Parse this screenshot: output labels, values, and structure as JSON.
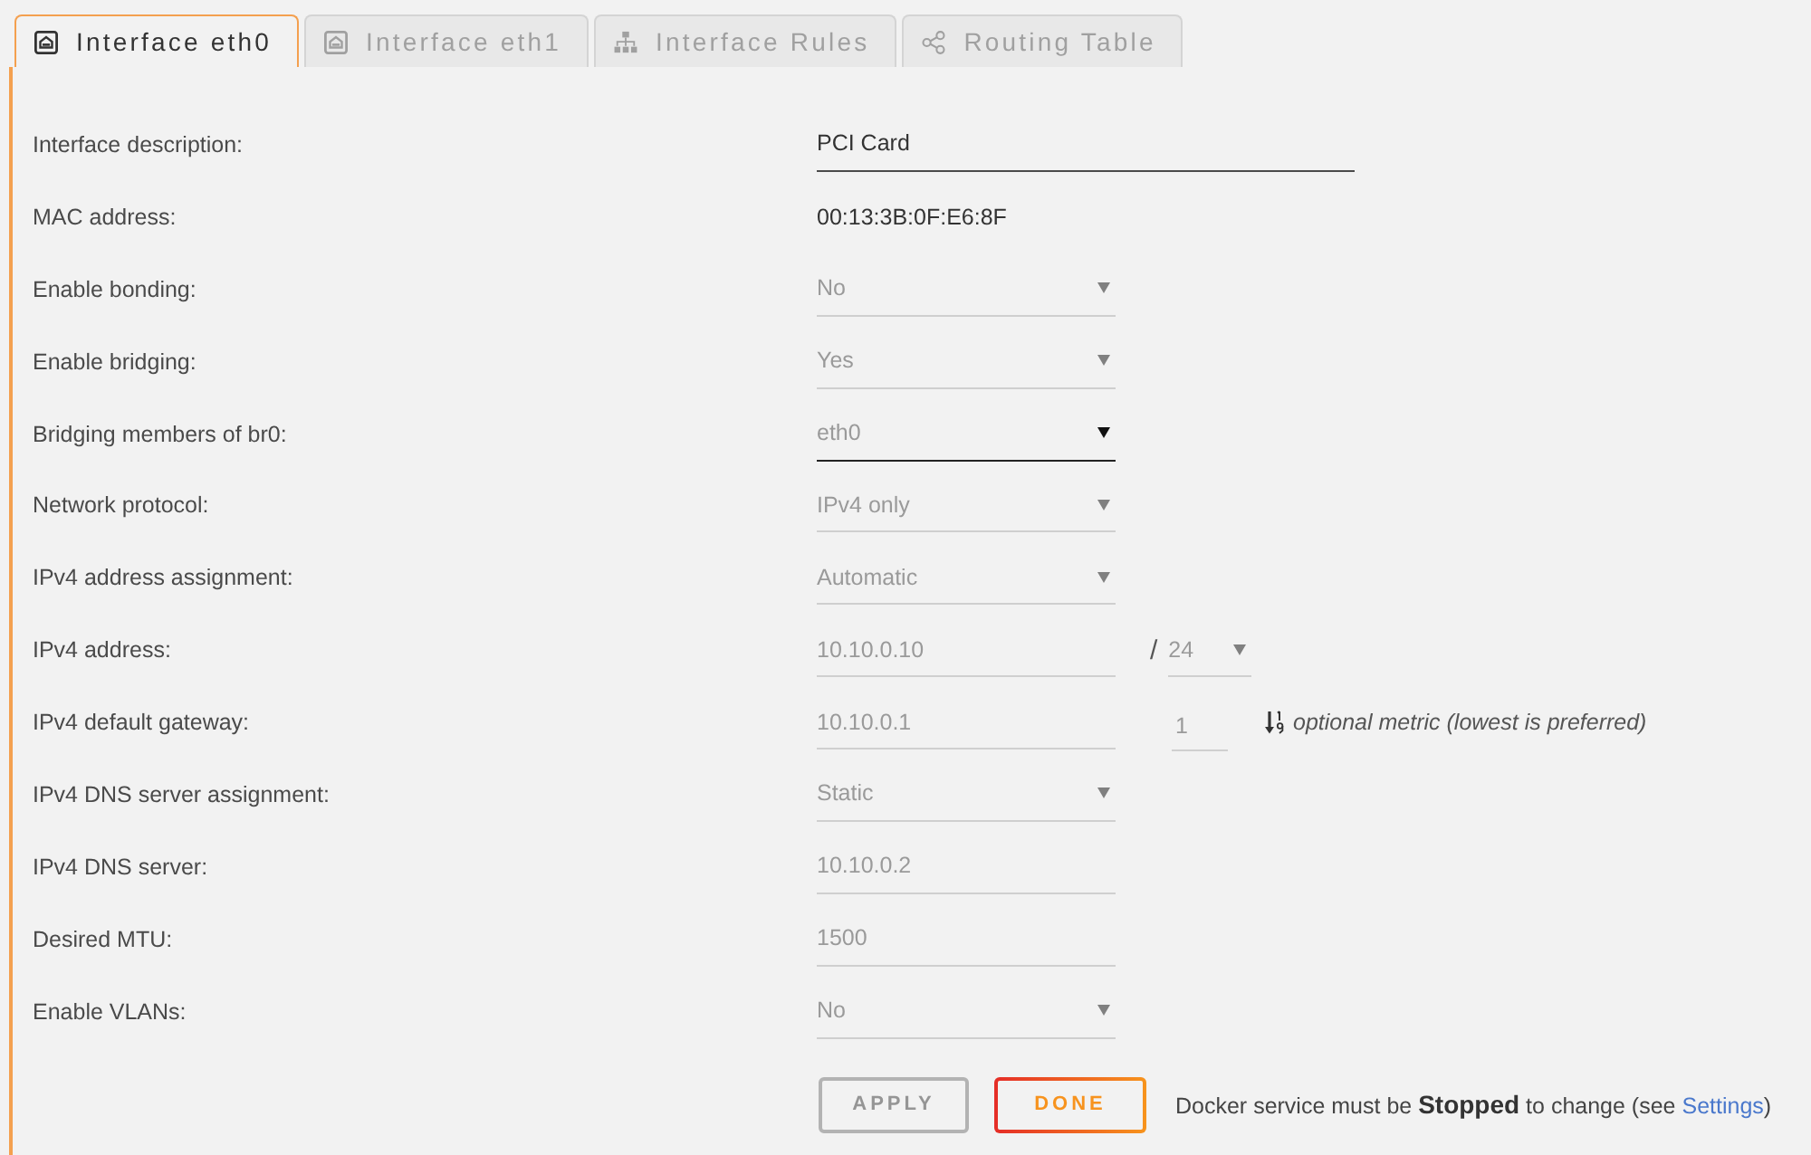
{
  "tabs": [
    {
      "label": "Interface eth0",
      "selected": true
    },
    {
      "label": "Interface eth1",
      "selected": false
    },
    {
      "label": "Interface Rules",
      "selected": false
    },
    {
      "label": "Routing Table",
      "selected": false
    }
  ],
  "fields": [
    {
      "label": "Interface description:",
      "kind": "text",
      "value": "PCI Card",
      "disabled": false
    },
    {
      "label": "MAC address:",
      "kind": "static",
      "value": "00:13:3B:0F:E6:8F"
    },
    {
      "label": "Enable bonding:",
      "kind": "select",
      "value": "No",
      "disabled": true
    },
    {
      "label": "Enable bridging:",
      "kind": "select",
      "value": "Yes",
      "disabled": true
    },
    {
      "label": "Bridging members of br0:",
      "kind": "select",
      "value": "eth0",
      "disabled": false
    },
    {
      "label": "Network protocol:",
      "kind": "select",
      "value": "IPv4 only",
      "disabled": true
    },
    {
      "label": "IPv4 address assignment:",
      "kind": "select",
      "value": "Automatic",
      "disabled": true
    },
    {
      "label": "IPv4 address:",
      "kind": "input",
      "value": "10.10.0.10",
      "disabled": true,
      "extra": {
        "kind": "prefix",
        "separator": "/",
        "value": "24",
        "disabled": true
      }
    },
    {
      "label": "IPv4 default gateway:",
      "kind": "input",
      "value": "10.10.0.1",
      "disabled": true,
      "extra": {
        "kind": "metric",
        "value": "1",
        "disabled": true,
        "hint": "optional metric (lowest is preferred)"
      }
    },
    {
      "label": "IPv4 DNS server assignment:",
      "kind": "select",
      "value": "Static",
      "disabled": true
    },
    {
      "label": "IPv4 DNS server:",
      "kind": "input",
      "value": "10.10.0.2",
      "disabled": true
    },
    {
      "label": "Desired MTU:",
      "kind": "input",
      "value": "1500",
      "disabled": true
    },
    {
      "label": "Enable VLANs:",
      "kind": "select",
      "value": "No",
      "disabled": true
    }
  ],
  "buttons": [
    {
      "label": "APPLY",
      "disabled": true
    },
    {
      "label": "DONE",
      "disabled": false
    }
  ],
  "note": {
    "text": "Docker service must be **Stopped** to change (see ",
    "link": "Settings",
    "close": ")"
  }
}
